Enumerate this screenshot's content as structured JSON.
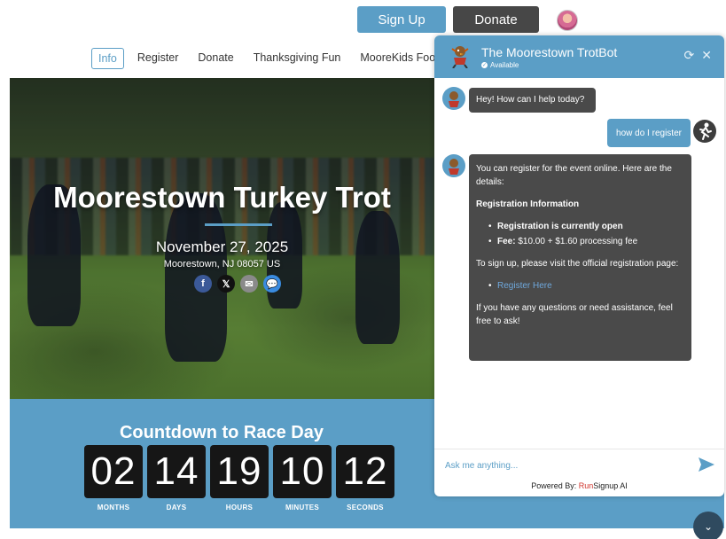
{
  "top": {
    "signup_label": "Sign Up",
    "donate_label": "Donate"
  },
  "nav": {
    "items": [
      {
        "label": "Info",
        "active": true
      },
      {
        "label": "Register"
      },
      {
        "label": "Donate"
      },
      {
        "label": "Thanksgiving Fun"
      },
      {
        "label": "MooreKids Food D"
      }
    ]
  },
  "hero": {
    "title": "Moorestown Turkey Trot",
    "date": "November 27, 2025",
    "location": "Moorestown, NJ 08057 US",
    "socials": [
      {
        "icon": "facebook-icon",
        "glyph": "f"
      },
      {
        "icon": "x-icon",
        "glyph": "𝕏"
      },
      {
        "icon": "email-icon",
        "glyph": "✉"
      },
      {
        "icon": "chat-icon",
        "glyph": "💬"
      }
    ]
  },
  "countdown": {
    "title": "Countdown to Race Day",
    "units": [
      {
        "value": "02",
        "label": "MONTHS"
      },
      {
        "value": "14",
        "label": "DAYS"
      },
      {
        "value": "19",
        "label": "HOURS"
      },
      {
        "value": "10",
        "label": "MINUTES"
      },
      {
        "value": "12",
        "label": "SECONDS"
      }
    ]
  },
  "chat": {
    "title": "The Moorestown TrotBot",
    "status": "Available",
    "messages": {
      "greeting": "Hey! How can I help today?",
      "user": "how do I register",
      "reply_intro": "You can register for the event online. Here are the details:",
      "reply_heading": "Registration Information",
      "reply_item1": "Registration is currently open",
      "reply_item2_label": "Fee:",
      "reply_item2_value": "$10.00 + $1.60 processing fee",
      "reply_signup": "To sign up, please visit the official registration page:",
      "reply_link": "Register Here",
      "reply_outro": "If you have any questions or need assistance, feel free to ask!"
    },
    "input_placeholder": "Ask me anything...",
    "powered_prefix": "Powered By: ",
    "powered_run": "Run",
    "powered_rest": "Signup AI"
  },
  "colors": {
    "accent": "#5b9ec6",
    "dark_button": "#474747",
    "bubble_bot": "#4a4a4a"
  }
}
